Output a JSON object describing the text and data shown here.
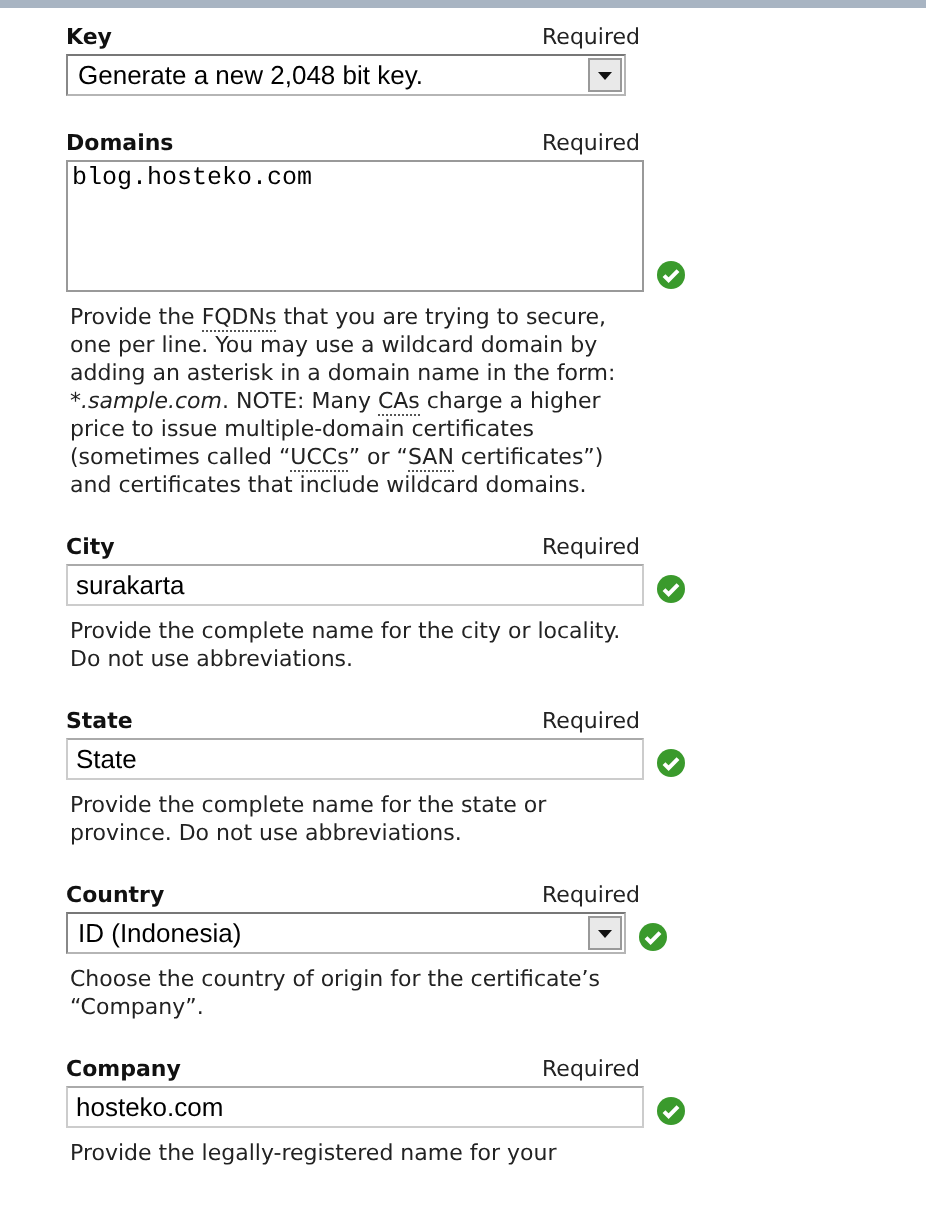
{
  "fields": [
    {
      "kind": "select",
      "label": "Key",
      "required": "Required",
      "value": "Generate a new 2,048 bit key."
    },
    {
      "kind": "textarea",
      "label": "Domains",
      "required": "Required",
      "value": "blog.hosteko.com",
      "valid": true,
      "help": [
        {
          "kind": "plain",
          "text": "Provide the "
        },
        {
          "kind": "abbr",
          "text": "FQDNs"
        },
        {
          "kind": "plain",
          "text": " that you are trying to secure, one per line. You may use a wildcard domain by adding an asterisk in a domain name in the form: "
        },
        {
          "kind": "italic",
          "text": "*.sample.com"
        },
        {
          "kind": "plain",
          "text": ". NOTE: Many "
        },
        {
          "kind": "abbr",
          "text": "CAs"
        },
        {
          "kind": "plain",
          "text": " charge a higher price to issue multiple-domain certificates (sometimes called “"
        },
        {
          "kind": "abbr",
          "text": "UCCs"
        },
        {
          "kind": "plain",
          "text": "” or “"
        },
        {
          "kind": "abbr",
          "text": "SAN"
        },
        {
          "kind": "plain",
          "text": " certificates”) and certificates that include wildcard domains."
        }
      ]
    },
    {
      "kind": "input",
      "label": "City",
      "required": "Required",
      "value": "surakarta",
      "valid": true,
      "help": [
        {
          "kind": "plain",
          "text": "Provide the complete name for the city or locality. Do not use abbreviations."
        }
      ]
    },
    {
      "kind": "input",
      "label": "State",
      "required": "Required",
      "value": "State",
      "valid": true,
      "help": [
        {
          "kind": "plain",
          "text": "Provide the complete name for the state or province. Do not use abbreviations."
        }
      ]
    },
    {
      "kind": "select",
      "label": "Country",
      "required": "Required",
      "value": "ID (Indonesia)",
      "valid": true,
      "help": [
        {
          "kind": "plain",
          "text": "Choose the country of origin for the certificate’s “Company”."
        }
      ]
    },
    {
      "kind": "input",
      "label": "Company",
      "required": "Required",
      "value": "hosteko.com",
      "valid": true,
      "help": [
        {
          "kind": "plain",
          "text": "Provide the legally-registered name for your"
        }
      ]
    }
  ]
}
